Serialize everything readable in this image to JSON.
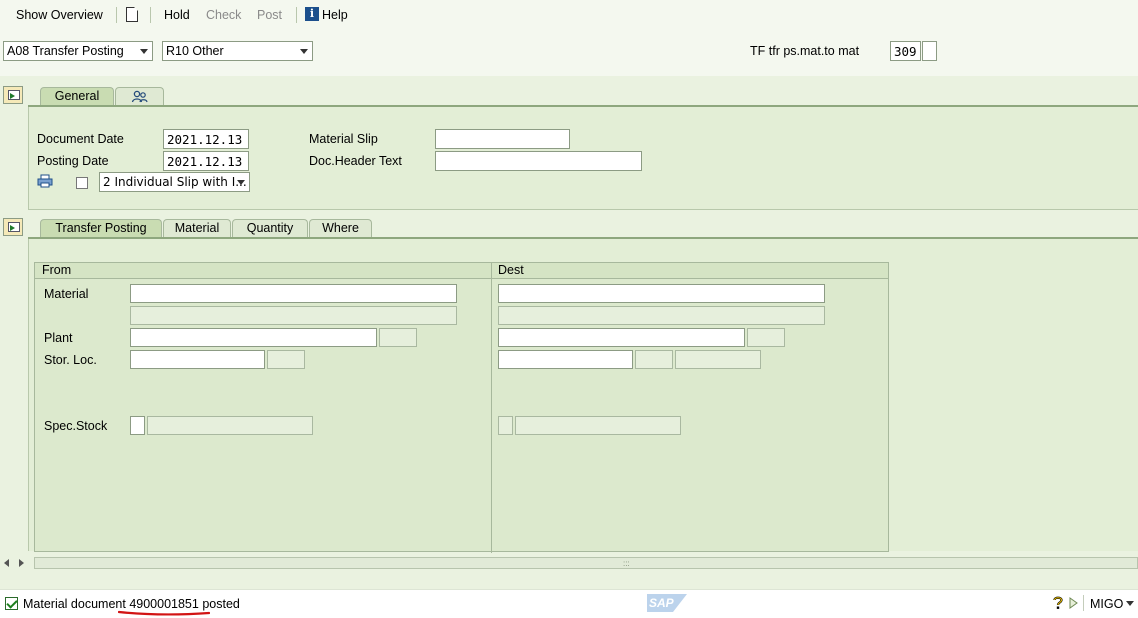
{
  "toolbar": {
    "show_overview": "Show Overview",
    "hold": "Hold",
    "check": "Check",
    "post": "Post",
    "help": "Help"
  },
  "header": {
    "action": "A08 Transfer Posting",
    "reference": "R10 Other",
    "movement_type_label": "TF tfr ps.mat.to mat",
    "movement_type": "309"
  },
  "general_tabs": {
    "general": "General"
  },
  "general": {
    "document_date_label": "Document Date",
    "document_date": "2021.12.13",
    "posting_date_label": "Posting Date",
    "posting_date": "2021.12.13",
    "material_slip_label": "Material Slip",
    "material_slip": "",
    "doc_header_text_label": "Doc.Header Text",
    "doc_header_text": "",
    "print_version": "2 Individual Slip with I..."
  },
  "detail_tabs": {
    "transfer_posting": "Transfer Posting",
    "material": "Material",
    "quantity": "Quantity",
    "where": "Where"
  },
  "transfer": {
    "from_label": "From",
    "dest_label": "Dest",
    "material_label": "Material",
    "plant_label": "Plant",
    "stor_loc_label": "Stor. Loc.",
    "spec_stock_label": "Spec.Stock"
  },
  "status_bar": {
    "message_prefix": "Material document ",
    "document_number": "4900001851",
    "message_suffix": " posted",
    "sap_logo": "SAP",
    "transaction": "MIGO"
  },
  "colors": {
    "accent_red_underline": "#d21414",
    "tab_active": "#c9dcb2",
    "background": "#eaf2e0"
  }
}
